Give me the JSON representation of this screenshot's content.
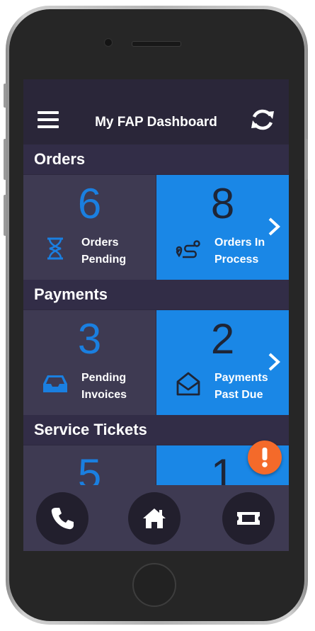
{
  "header": {
    "title": "My FAP Dashboard",
    "menu_icon": "hamburger-menu-icon",
    "refresh_icon": "refresh-icon"
  },
  "sections": {
    "orders": {
      "title": "Orders",
      "left": {
        "count": "6",
        "label_line1": "Orders",
        "label_line2": "Pending",
        "icon": "hourglass-icon"
      },
      "right": {
        "count": "8",
        "label_line1": "Orders In",
        "label_line2": "Process",
        "icon": "route-icon"
      }
    },
    "payments": {
      "title": "Payments",
      "left": {
        "count": "3",
        "label_line1": "Pending",
        "label_line2": "Invoices",
        "icon": "inbox-tray-icon"
      },
      "right": {
        "count": "2",
        "label_line1": "Payments",
        "label_line2": "Past Due",
        "icon": "open-envelope-icon"
      }
    },
    "service_tickets": {
      "title": "Service Tickets",
      "left": {
        "count": "5"
      },
      "right": {
        "count": "1"
      }
    }
  },
  "fab": {
    "icon": "exclamation-icon"
  },
  "bottom_nav": [
    {
      "icon": "phone-icon"
    },
    {
      "icon": "home-icon"
    },
    {
      "icon": "ticket-icon"
    }
  ],
  "colors": {
    "accent_blue": "#1a87e6",
    "count_blue": "#1a7fe0",
    "tile_dark": "#3e3a52",
    "header_bg": "#2a2639",
    "section_bg": "#322d47",
    "alert_orange": "#f46a2a"
  }
}
